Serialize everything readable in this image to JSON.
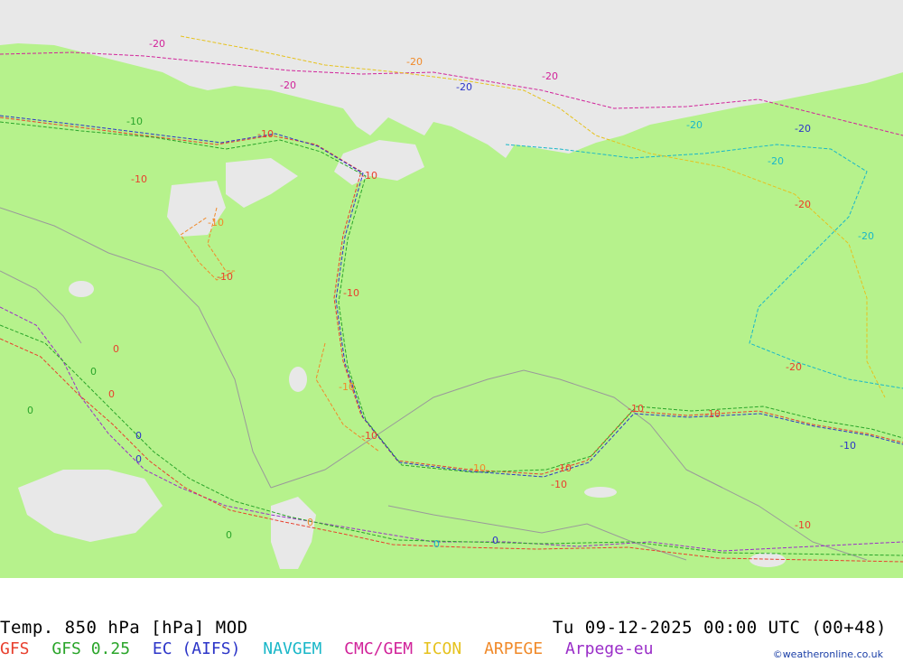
{
  "title": "Temp. 850 hPa [hPa] MOD",
  "valid_time": "Tu 09-12-2025 00:00 UTC (00+48)",
  "credit": "©weatheronline.co.uk",
  "models": [
    {
      "label": "GFS",
      "color": "#e8402e"
    },
    {
      "label": "GFS 0.25",
      "color": "#2aa52a"
    },
    {
      "label": "EC (AIFS)",
      "color": "#2c35c8"
    },
    {
      "label": "NAVGEM",
      "color": "#19b7c8"
    },
    {
      "label": "CMC/GEM",
      "color": "#d1239a"
    },
    {
      "label": "ICON",
      "color": "#e6c21e"
    },
    {
      "label": "ARPEGE",
      "color": "#f08a2a"
    },
    {
      "label": "Arpege-eu",
      "color": "#9a2ec8"
    }
  ],
  "colors": {
    "land": "#b6f28c",
    "ocean": "#e8e8e8",
    "border": "#9a9a9a"
  },
  "contour_levels": [
    "-20",
    "-10",
    "0"
  ]
}
